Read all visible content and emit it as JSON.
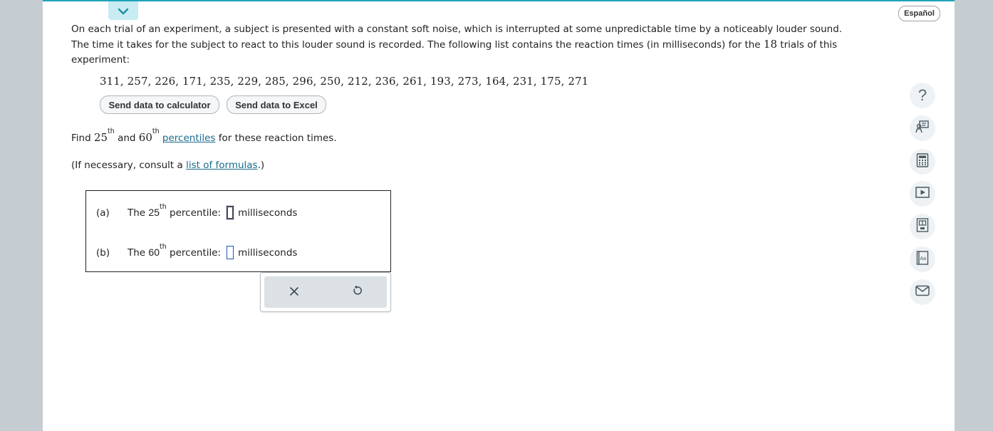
{
  "header": {
    "language_button": "Español"
  },
  "problem": {
    "line1": "On each trial of an experiment, a subject is presented with a constant soft noise, which is interrupted at some unpredictable time by a noticeably louder sound.",
    "line2_pre": "The time it takes for the subject to react to this louder sound is recorded. The following list contains the reaction times (in milliseconds) for the ",
    "trial_count": "18",
    "line2_post": " trials of this",
    "line3": "experiment:",
    "data": "311, 257, 226, 171, 235, 229, 285, 296, 250, 212, 236, 261, 193, 273, 164, 231, 175, 271"
  },
  "buttons": {
    "send_calculator": "Send data to calculator",
    "send_excel": "Send data to Excel"
  },
  "question": {
    "find": "Find ",
    "p1": "25",
    "th": "th",
    "and": " and ",
    "p2": "60",
    "link": "percentiles",
    "tail": " for these reaction times."
  },
  "formulas": {
    "pre": "(If necessary, consult a ",
    "link": "list of formulas",
    "post": ".)"
  },
  "answers": [
    {
      "label": "(a)",
      "text_pre": "The ",
      "num": "25",
      "th": "th",
      "text_post": " percentile:",
      "value": "",
      "unit": "milliseconds"
    },
    {
      "label": "(b)",
      "text_pre": "The ",
      "num": "60",
      "th": "th",
      "text_post": " percentile:",
      "value": "",
      "unit": "milliseconds"
    }
  ],
  "icons": [
    "chevron-down-icon",
    "help-icon",
    "tutor-icon",
    "calculator-icon",
    "video-icon",
    "ebook-icon",
    "glossary-icon",
    "email-icon",
    "clear-icon",
    "undo-icon"
  ],
  "colors": {
    "accent": "#1fa3b8",
    "link": "#1a6c8b",
    "input_border": "#2354b7"
  }
}
